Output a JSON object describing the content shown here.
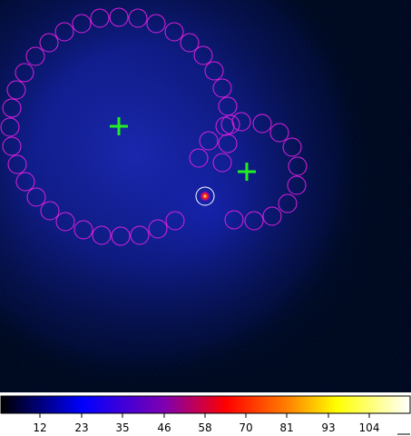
{
  "image": {
    "background": "#000000",
    "glow_color": "#1e22c8",
    "source_color": "#ff2200"
  },
  "regions": {
    "source_circle_color": "#ffffff",
    "background_circle_color": "#e020e0",
    "marker_color": "#22ee22"
  },
  "colorbar": {
    "ticks": [
      "12",
      "23",
      "35",
      "46",
      "58",
      "70",
      "81",
      "93",
      "104"
    ]
  }
}
